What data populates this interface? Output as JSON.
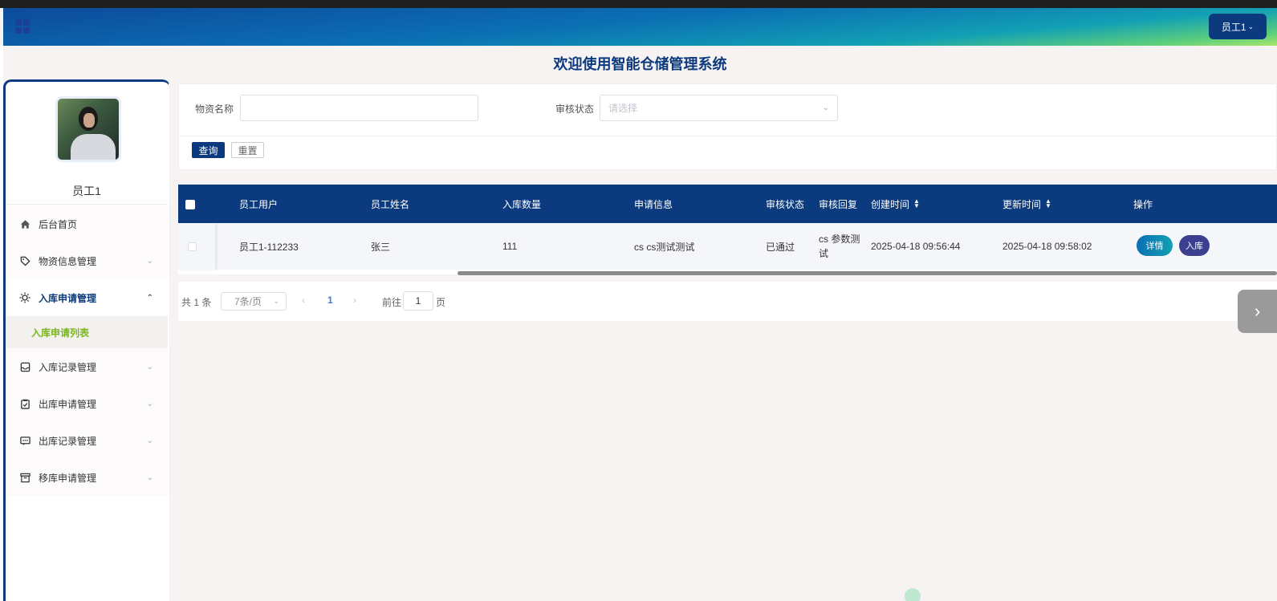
{
  "header": {
    "user_menu_label": "员工1"
  },
  "page_title": "欢迎使用智能仓储管理系统",
  "sidebar": {
    "user_name": "员工1",
    "items": [
      {
        "label": "后台首页",
        "icon": "home-icon"
      },
      {
        "label": "物资信息管理",
        "icon": "tag-icon"
      },
      {
        "label": "入库申请管理",
        "icon": "sun-icon",
        "sub": [
          {
            "label": "入库申请列表"
          }
        ]
      },
      {
        "label": "入库记录管理",
        "icon": "inbox-icon"
      },
      {
        "label": "出库申请管理",
        "icon": "clipboard-check-icon"
      },
      {
        "label": "出库记录管理",
        "icon": "message-icon"
      },
      {
        "label": "移库申请管理",
        "icon": "archive-icon"
      }
    ]
  },
  "search": {
    "material_label": "物资名称",
    "material_value": "",
    "status_label": "审核状态",
    "status_placeholder": "请选择",
    "query_label": "查询",
    "reset_label": "重置"
  },
  "table": {
    "columns": [
      "员工用户",
      "员工姓名",
      "入库数量",
      "申请信息",
      "审核状态",
      "审核回复",
      "创建时间",
      "更新时间",
      "操作"
    ],
    "rows": [
      {
        "user": "员工1-112233",
        "name": "张三",
        "quantity": "111",
        "info": "cs cs测试测试",
        "status": "已通过",
        "reply": "cs 参数测试",
        "created": "2025-04-18 09:56:44",
        "updated": "2025-04-18 09:58:02",
        "detail_label": "详情",
        "inbound_label": "入库"
      }
    ]
  },
  "pagination": {
    "total": "共 1 条",
    "page_size": "7条/页",
    "current_page": "1",
    "goto_label": "前往",
    "goto_value": "1",
    "page_suffix": "页"
  },
  "colors": {
    "primary": "#0b3a7e",
    "active_sub": "#7ab51d",
    "detail_btn": "#0e7fc0",
    "inbound_btn": "#3b3f8f"
  }
}
